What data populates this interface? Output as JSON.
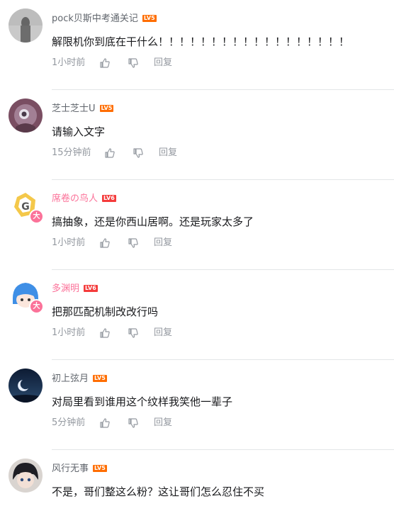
{
  "comments": [
    {
      "username": "pock贝斯中考通关记",
      "username_color": "normal",
      "level": "LV5",
      "text": "解限机你到底在干什么！！！！！！！！！！！！！！！！！！",
      "time": "1小时前",
      "reply_label": "回复",
      "vip_badge": ""
    },
    {
      "username": "芝士芝士U",
      "username_color": "normal",
      "level": "LV5",
      "text": "请输入文字",
      "time": "15分钟前",
      "reply_label": "回复",
      "vip_badge": ""
    },
    {
      "username": "席卷の鸟人",
      "username_color": "pink",
      "level": "LV6",
      "text": "搞抽象，还是你西山居啊。还是玩家太多了",
      "time": "1小时前",
      "reply_label": "回复",
      "vip_badge": "大"
    },
    {
      "username": "多渊明",
      "username_color": "pink",
      "level": "LV6",
      "text": "把那匹配机制改改行吗",
      "time": "1小时前",
      "reply_label": "回复",
      "vip_badge": "大"
    },
    {
      "username": "初上弦月",
      "username_color": "normal",
      "level": "LV5",
      "text": "对局里看到谁用这个纹样我笑他一辈子",
      "time": "5分钟前",
      "reply_label": "回复",
      "vip_badge": ""
    },
    {
      "username": "风行无事",
      "username_color": "normal",
      "level": "LV5",
      "text": "不是，哥们整这么粉？这让哥们怎么忍住不买",
      "time": "",
      "reply_label": "",
      "vip_badge": ""
    }
  ],
  "icons": {
    "like": "thumbs-up-icon",
    "dislike": "thumbs-down-icon"
  },
  "colors": {
    "level_badge": "#ff6d00",
    "vip_name": "#fb7299",
    "meta_text": "#9499a0",
    "divider": "#e3e5e7"
  }
}
